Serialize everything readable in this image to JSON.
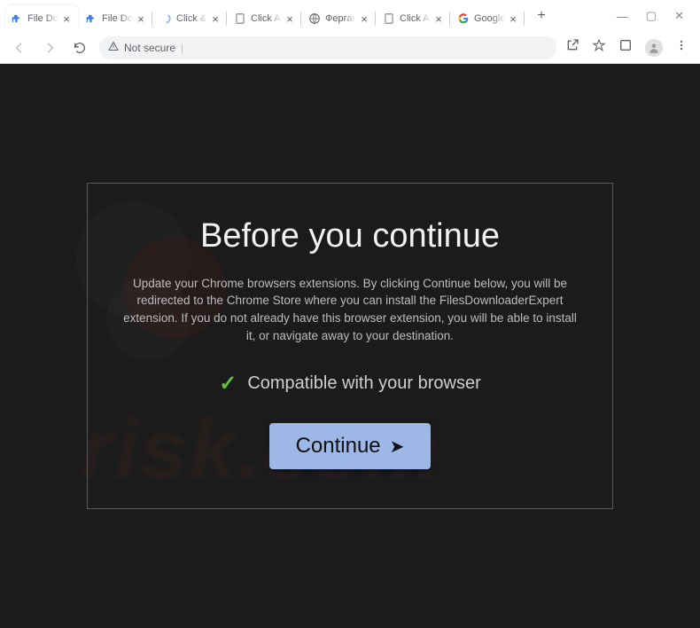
{
  "window": {
    "tabs": [
      {
        "favicon": "puzzle-blue",
        "title": "File Downl",
        "active": true
      },
      {
        "favicon": "puzzle-blue",
        "title": "File Downl",
        "active": false
      },
      {
        "favicon": "spinner",
        "title": "Click &qu",
        "active": false
      },
      {
        "favicon": "page",
        "title": "Click Allow",
        "active": false
      },
      {
        "favicon": "globe",
        "title": "Фергана",
        "active": false
      },
      {
        "favicon": "page",
        "title": "Click Allow",
        "active": false
      },
      {
        "favicon": "google",
        "title": "Google",
        "active": false
      }
    ],
    "newtab_label": "+",
    "controls": {
      "min": "—",
      "max": "▢",
      "close": "✕"
    }
  },
  "toolbar": {
    "security_text": "Not secure",
    "url": "",
    "icons": {
      "share": "share-icon",
      "star": "star-icon",
      "ext": "extension-icon",
      "profile": "profile-icon",
      "menu": "menu-icon"
    }
  },
  "modal": {
    "heading": "Before you continue",
    "body": "Update your Chrome browsers extensions. By clicking Continue below, you will be redirected to the Chrome Store where you can install the FilesDownloaderExpert extension. If you do not already have this browser extension, you will be able to install it, or navigate away to your destination.",
    "compat_text": "Compatible with your browser",
    "continue_label": "Continue",
    "arrow": "➤"
  },
  "watermark": {
    "text": "risk.com"
  }
}
